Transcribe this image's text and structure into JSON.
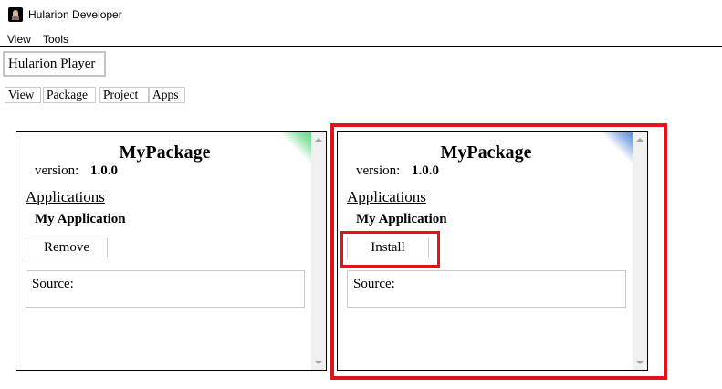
{
  "window": {
    "title": "Hularion Developer"
  },
  "menu": {
    "items": [
      "View",
      "Tools"
    ]
  },
  "player_button": "Hularion Player",
  "tabs": [
    "View",
    "Package",
    "Project",
    "Apps"
  ],
  "packages": [
    {
      "name": "MyPackage",
      "version_label": "version:",
      "version": "1.0.0",
      "applications_label": "Applications",
      "application": "My Application",
      "action": "Remove",
      "source_label": "Source:",
      "corner_color": "#4fd27a"
    },
    {
      "name": "MyPackage",
      "version_label": "version:",
      "version": "1.0.0",
      "applications_label": "Applications",
      "application": "My Application",
      "action": "Install",
      "source_label": "Source:",
      "corner_color": "#3e7fd6"
    }
  ],
  "highlight_color": "#e3131b"
}
